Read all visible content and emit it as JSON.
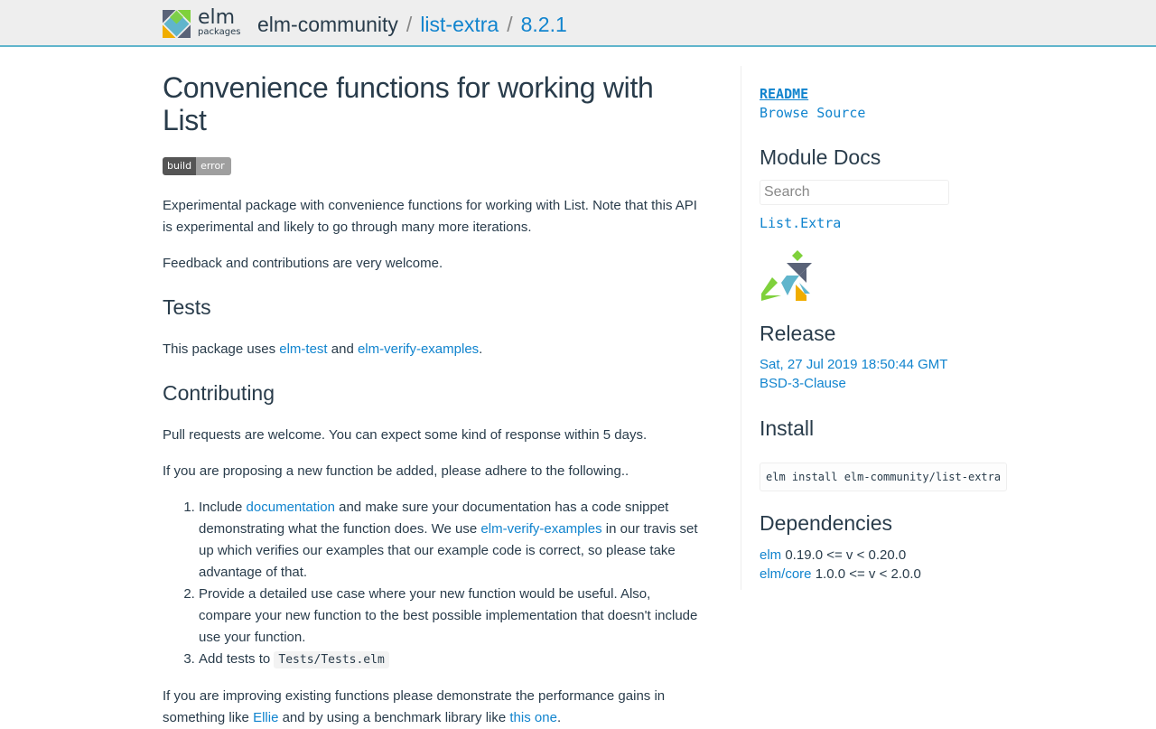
{
  "header": {
    "logo_word": "elm",
    "logo_sub": "packages",
    "user": "elm-community",
    "sep": "/",
    "package": "list-extra",
    "version": "8.2.1"
  },
  "main": {
    "title": "Convenience functions for working with List",
    "badge_left": "build",
    "badge_right": "error",
    "intro": "Experimental package with convenience functions for working with List. Note that this API is experimental and likely to go through many more iterations.",
    "feedback": "Feedback and contributions are very welcome.",
    "tests_heading": "Tests",
    "tests_pre": "This package uses ",
    "tests_link1": "elm-test",
    "tests_mid": " and ",
    "tests_link2": "elm-verify-examples",
    "tests_post": ".",
    "contrib_heading": "Contributing",
    "pr_text": "Pull requests are welcome. You can expect some kind of response within 5 days.",
    "propose_text": "If you are proposing a new function be added, please adhere to the following..",
    "list": {
      "i1_pre": "Include ",
      "i1_link1": "documentation",
      "i1_mid": " and make sure your documentation has a code snippet demonstrating what the function does. We use ",
      "i1_link2": "elm-verify-examples",
      "i1_post": " in our travis set up which verifies our examples that our example code is correct, so please take advantage of that.",
      "i2": "Provide a detailed use case where your new function would be useful. Also, compare your new function to the best possible implementation that doesn't include use your function.",
      "i3_pre": "Add tests to ",
      "i3_code": "Tests/Tests.elm"
    },
    "improve_pre": "If you are improving existing functions please demonstrate the performance gains in something like ",
    "improve_link1": "Ellie",
    "improve_mid": " and by using a benchmark library like ",
    "improve_link2": "this one",
    "improve_post": "."
  },
  "sidebar": {
    "readme": "README",
    "browse_source": "Browse Source",
    "module_docs_heading": "Module Docs",
    "search_placeholder": "Search",
    "module_link": "List.Extra",
    "release_heading": "Release",
    "release_date": "Sat, 27 Jul 2019 18:50:44 GMT",
    "license": "BSD-3-Clause",
    "install_heading": "Install",
    "install_cmd": "elm install elm-community/list-extra",
    "deps_heading": "Dependencies",
    "deps": [
      {
        "name": "elm",
        "range": " 0.19.0 <= v < 0.20.0"
      },
      {
        "name": "elm/core",
        "range": " 1.0.0 <= v < 2.0.0"
      }
    ]
  },
  "colors": {
    "accent_link": "#1184ce",
    "header_border": "#60b5cc",
    "text": "#293c4b",
    "tangram_green": "#7fd13b",
    "tangram_blue": "#60b5cc",
    "tangram_orange": "#f0ad00",
    "tangram_dark": "#5a6378"
  },
  "icons": {
    "logo": "elm-tangram-logo-icon",
    "tangram": "elm-tangram-figure-icon"
  }
}
